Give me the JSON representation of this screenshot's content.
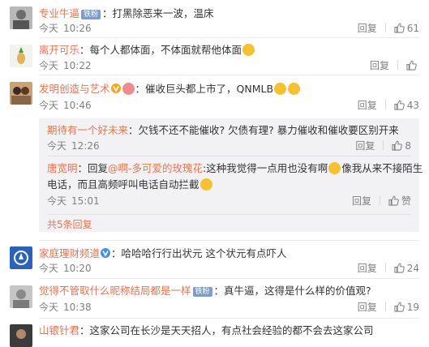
{
  "comments": [
    {
      "username": "专业牛逼",
      "badge": "铁粉",
      "text": "：打黑除恶来一波，温床",
      "date": "今天",
      "time": "10:26",
      "reply_label": "回复",
      "likes": "61"
    },
    {
      "username": "离开可乐",
      "text": "：每个人都体面，不体面就帮他体面",
      "date": "今天",
      "time": "10:22",
      "reply_label": "回复",
      "likes": ""
    },
    {
      "username": "发明创造与艺术",
      "text": "：催收巨头都上市了，QNMLB",
      "date": "今天",
      "time": "10:46",
      "reply_label": "回复",
      "likes": "43",
      "replies": [
        {
          "username": "期待有一个好未来",
          "text": "：欠钱不还不能催收? 欠债有理? 暴力催收和催收要区别开来",
          "date": "今天",
          "time": "12:26",
          "reply_label": "回复",
          "likes": "8"
        },
        {
          "username": "唐宽明",
          "text_prefix": "：回复",
          "mention": "@啊-多可爱的玫瑰花",
          "text_line1": ":这种我觉得一点用也没有啊",
          "text_line1b": "像我从来不接陌生",
          "text_line2": "电话，而且高频呼叫电话自动拦截",
          "date": "今天",
          "time": "15:01",
          "reply_label": "回复",
          "likes": "赞"
        }
      ],
      "more_replies": "共5条回复"
    },
    {
      "username": "家庭理财频道",
      "text": "：哈哈哈行行出状元 这个状元有点吓人",
      "date": "今天",
      "time": "10:20",
      "reply_label": "回复",
      "likes": "24"
    },
    {
      "username": "觉得不管取什么昵称结局都是一样",
      "badge": "铁粉",
      "text": "：真牛逼，这得是什么样的价值观?",
      "date": "今天",
      "time": "10:38",
      "reply_label": "回复",
      "likes": "19"
    },
    {
      "username": "山银针君",
      "text": "：这家公司在长沙是天天招人，有点社会经验的都不会去这家公司"
    }
  ],
  "colors": {
    "username": "#eb7350",
    "meta": "#808080",
    "badge": "#7d9cc8",
    "reply_box": "#f2f2f5"
  },
  "icons": [
    "thumb-up-icon",
    "verified-v-icon",
    "emoji-icon"
  ]
}
